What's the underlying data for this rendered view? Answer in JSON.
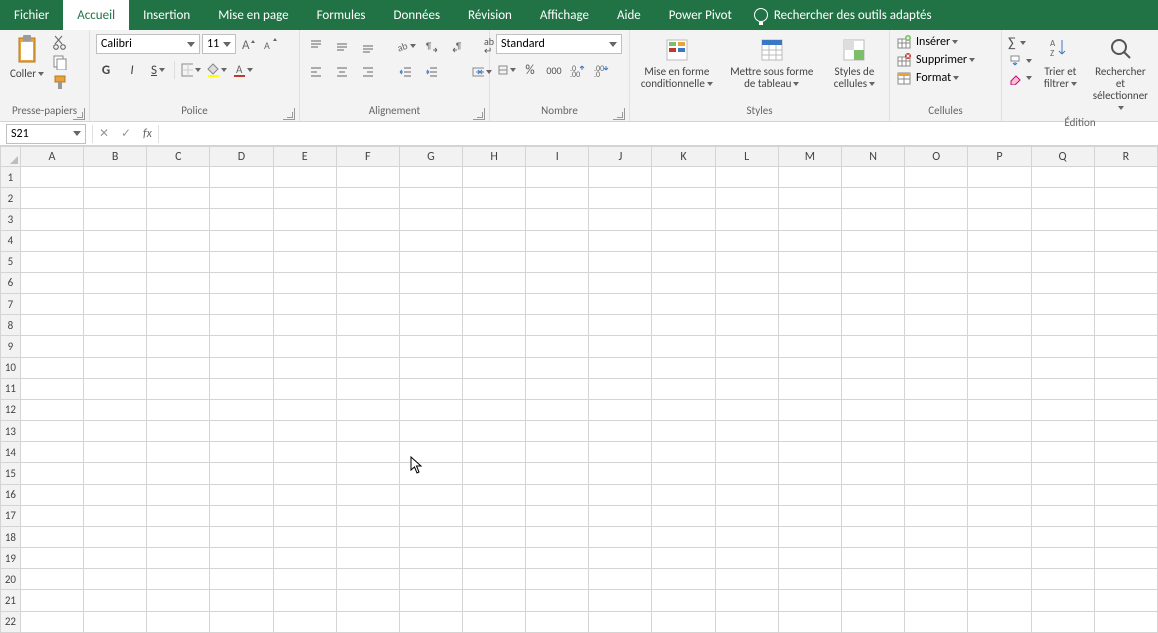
{
  "tabs": [
    "Fichier",
    "Accueil",
    "Insertion",
    "Mise en page",
    "Formules",
    "Données",
    "Révision",
    "Affichage",
    "Aide",
    "Power Pivot"
  ],
  "activeTab": "Accueil",
  "tellme": "Rechercher des outils adaptés",
  "ribbon": {
    "clipboard": {
      "paste": "Coller",
      "label": "Presse-papiers"
    },
    "font": {
      "name": "Calibri",
      "size": "11",
      "bold": "G",
      "italic": "I",
      "underline": "S",
      "label": "Police"
    },
    "align": {
      "wrap": "ab",
      "label": "Alignement"
    },
    "number": {
      "format": "Standard",
      "label": "Nombre"
    },
    "styles": {
      "cond": "Mise en forme conditionnelle",
      "tbl": "Mettre sous forme de tableau",
      "cell": "Styles de cellules",
      "label": "Styles"
    },
    "cells": {
      "insert": "Insérer",
      "delete": "Supprimer",
      "format": "Format",
      "label": "Cellules"
    },
    "editing": {
      "sort": "Trier et filtrer",
      "find": "Rechercher et sélectionner",
      "label": "Édition"
    }
  },
  "formulaBar": {
    "name": "S21",
    "cancel": "✕",
    "enter": "✓",
    "fx": "fx"
  },
  "cols": [
    "A",
    "B",
    "C",
    "D",
    "E",
    "F",
    "G",
    "H",
    "I",
    "J",
    "K",
    "L",
    "M",
    "N",
    "O",
    "P",
    "Q",
    "R"
  ],
  "rows": [
    "1",
    "2",
    "3",
    "4",
    "5",
    "6",
    "7",
    "8",
    "9",
    "10",
    "11",
    "12",
    "13",
    "14",
    "15",
    "16",
    "17",
    "18",
    "19",
    "20",
    "21",
    "22"
  ]
}
